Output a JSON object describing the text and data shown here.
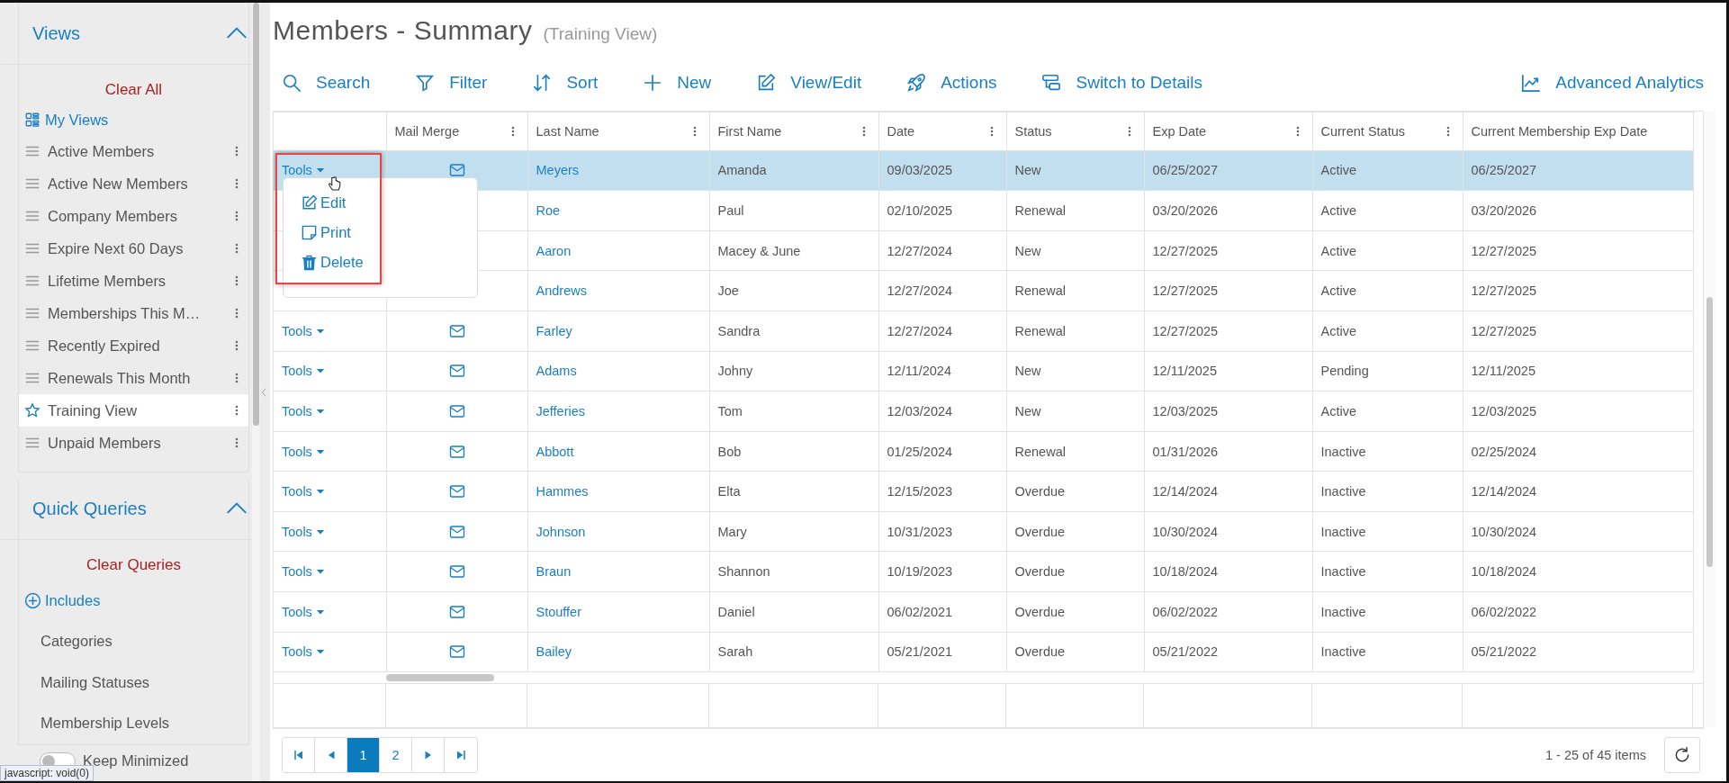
{
  "sidebar": {
    "views": {
      "title": "Views",
      "expanded": true,
      "clear": "Clear All",
      "my_views": "My Views",
      "items": [
        {
          "label": "Active Members",
          "kind": "list",
          "selected": false
        },
        {
          "label": "Active New Members",
          "kind": "list",
          "selected": false
        },
        {
          "label": "Company Members",
          "kind": "list",
          "selected": false
        },
        {
          "label": "Expire Next 60 Days",
          "kind": "list",
          "selected": false
        },
        {
          "label": "Lifetime Members",
          "kind": "list",
          "selected": false
        },
        {
          "label": "Memberships This M…",
          "kind": "list",
          "selected": false
        },
        {
          "label": "Recently Expired",
          "kind": "list",
          "selected": false
        },
        {
          "label": "Renewals This Month",
          "kind": "list",
          "selected": false
        },
        {
          "label": "Training View",
          "kind": "favorite",
          "selected": true
        },
        {
          "label": "Unpaid Members",
          "kind": "list",
          "selected": false
        }
      ]
    },
    "quick_queries": {
      "title": "Quick Queries",
      "expanded": true,
      "clear": "Clear Queries",
      "includes": "Includes",
      "items": [
        "Categories",
        "Mailing Statuses",
        "Membership Levels"
      ]
    },
    "keep_minimized": {
      "label": "Keep Minimized",
      "on": false
    }
  },
  "status_bar": "javascript: void(0)",
  "page": {
    "title": "Members - Summary",
    "subtitle": "(Training View)"
  },
  "toolbar": [
    {
      "label": "Search",
      "kind": "search"
    },
    {
      "label": "Filter",
      "kind": "filter"
    },
    {
      "label": "Sort",
      "kind": "sort"
    },
    {
      "label": "New",
      "kind": "new"
    },
    {
      "label": "View/Edit",
      "kind": "edit"
    },
    {
      "label": "Actions",
      "kind": "actions"
    },
    {
      "label": "Switch to Details",
      "kind": "switch"
    }
  ],
  "toolbar_right": {
    "label": "Advanced Analytics",
    "kind": "analytics"
  },
  "table": {
    "columns": [
      {
        "label": "Mail Merge",
        "menu": true
      },
      {
        "label": "Last Name",
        "menu": true
      },
      {
        "label": "First Name",
        "menu": true
      },
      {
        "label": "Date",
        "menu": true
      },
      {
        "label": "Status",
        "menu": true
      },
      {
        "label": "Exp Date",
        "menu": true
      },
      {
        "label": "Current Status",
        "menu": true
      },
      {
        "label": "Current Membership Exp Date",
        "menu": false
      }
    ],
    "rows": [
      {
        "tools": "Tools",
        "mail": true,
        "selected": true,
        "cells": [
          "",
          "Meyers",
          "Amanda",
          "09/03/2025",
          "New",
          "06/25/2027",
          "Active",
          "06/25/2027"
        ]
      },
      {
        "mail": false,
        "selected": false,
        "cells": [
          "",
          "Roe",
          "Paul",
          "02/10/2025",
          "Renewal",
          "03/20/2026",
          "Active",
          "03/20/2026"
        ]
      },
      {
        "mail": false,
        "selected": false,
        "cells": [
          "",
          "Aaron",
          "Macey & June",
          "12/27/2024",
          "New",
          "12/27/2025",
          "Active",
          "12/27/2025"
        ]
      },
      {
        "mail": false,
        "selected": false,
        "cells": [
          "",
          "Andrews",
          "Joe",
          "12/27/2024",
          "Renewal",
          "12/27/2025",
          "Active",
          "12/27/2025"
        ]
      },
      {
        "tools": "Tools",
        "mail": true,
        "selected": false,
        "cells": [
          "",
          "Farley",
          "Sandra",
          "12/27/2024",
          "Renewal",
          "12/27/2025",
          "Active",
          "12/27/2025"
        ]
      },
      {
        "tools": "Tools",
        "mail": true,
        "selected": false,
        "cells": [
          "",
          "Adams",
          "Johny",
          "12/11/2024",
          "New",
          "12/11/2025",
          "Pending",
          "12/11/2025"
        ]
      },
      {
        "tools": "Tools",
        "mail": true,
        "selected": false,
        "cells": [
          "",
          "Jefferies",
          "Tom",
          "12/03/2024",
          "New",
          "12/03/2025",
          "Active",
          "12/03/2025"
        ]
      },
      {
        "tools": "Tools",
        "mail": true,
        "selected": false,
        "cells": [
          "",
          "Abbott",
          "Bob",
          "01/25/2024",
          "Renewal",
          "01/31/2026",
          "Inactive",
          "02/25/2024"
        ]
      },
      {
        "tools": "Tools",
        "mail": true,
        "selected": false,
        "cells": [
          "",
          "Hammes",
          "Elta",
          "12/15/2023",
          "Overdue",
          "12/14/2024",
          "Inactive",
          "12/14/2024"
        ]
      },
      {
        "tools": "Tools",
        "mail": true,
        "selected": false,
        "cells": [
          "",
          "Johnson",
          "Mary",
          "10/31/2023",
          "Overdue",
          "10/30/2024",
          "Inactive",
          "10/30/2024"
        ]
      },
      {
        "tools": "Tools",
        "mail": true,
        "selected": false,
        "cells": [
          "",
          "Braun",
          "Shannon",
          "10/19/2023",
          "Overdue",
          "10/18/2024",
          "Inactive",
          "10/18/2024"
        ]
      },
      {
        "tools": "Tools",
        "mail": true,
        "selected": false,
        "cells": [
          "",
          "Stouffer",
          "Daniel",
          "06/02/2021",
          "Overdue",
          "06/02/2022",
          "Inactive",
          "06/02/2022"
        ]
      },
      {
        "tools": "Tools",
        "mail": true,
        "selected": false,
        "cells": [
          "",
          "Bailey",
          "Sarah",
          "05/21/2021",
          "Overdue",
          "05/21/2022",
          "Inactive",
          "05/21/2022"
        ]
      }
    ]
  },
  "tools_menu": {
    "items": [
      {
        "label": "Edit",
        "kind": "edit"
      },
      {
        "label": "Print",
        "kind": "print"
      },
      {
        "label": "Delete",
        "kind": "delete"
      }
    ]
  },
  "pager": {
    "pages": [
      {
        "label": "1",
        "selected": true
      },
      {
        "label": "2",
        "selected": false
      }
    ],
    "summary": "1 - 25 of 45 items"
  }
}
